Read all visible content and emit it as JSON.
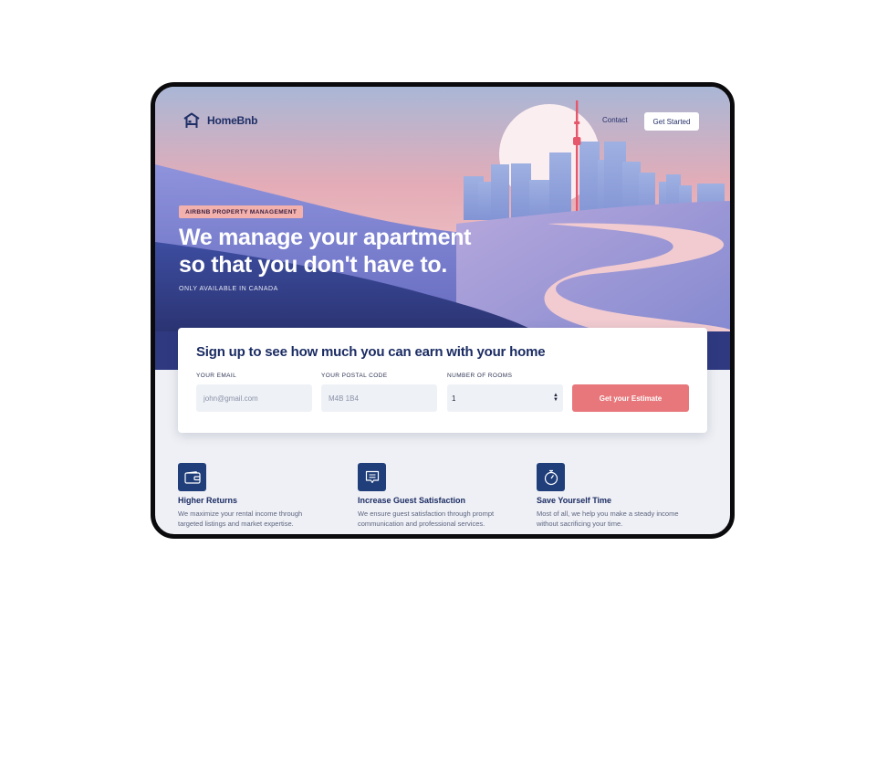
{
  "nav": {
    "brand": "HomeBnb",
    "contact": "Contact",
    "get_started": "Get Started"
  },
  "hero": {
    "badge": "AIRBNB PROPERTY MANAGEMENT",
    "headline_line1": "We manage your apartment",
    "headline_line2": "so that you don't have to.",
    "subline": "ONLY AVAILABLE IN CANADA"
  },
  "signup": {
    "title": "Sign up to see how much you can earn with your home",
    "email_label": "YOUR EMAIL",
    "email_placeholder": "john@gmail.com",
    "postal_label": "YOUR POSTAL CODE",
    "postal_placeholder": "M4B 1B4",
    "rooms_label": "NUMBER OF ROOMS",
    "rooms_value": "1",
    "cta": "Get your Estimate"
  },
  "features": [
    {
      "icon": "wallet-icon",
      "title": "Higher Returns",
      "line1": "We maximize your rental income through",
      "line2": "targeted listings and market expertise."
    },
    {
      "icon": "message-icon",
      "title": "Increase Guest Satisfaction",
      "line1": "We ensure guest satisfaction through prompt",
      "line2": "communication and professional services."
    },
    {
      "icon": "stopwatch-icon",
      "title": "Save Yourself Time",
      "line1": "Most of all, we help you make a steady income",
      "line2": "without sacrificing your time."
    }
  ],
  "colors": {
    "brand_navy": "#1f3e7a",
    "cta_coral": "#e8777b",
    "badge_pink": "#f2b1ad",
    "heading_navy": "#1b2c63"
  }
}
